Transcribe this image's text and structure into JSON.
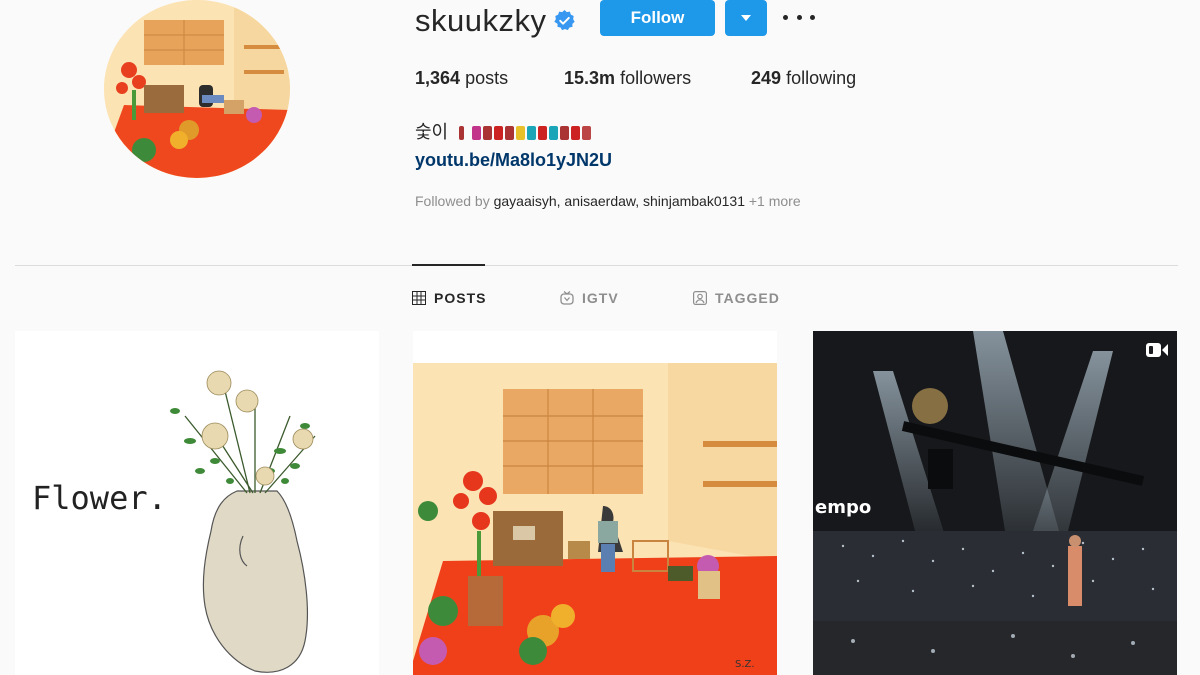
{
  "profile": {
    "username": "skuukzky",
    "follow_label": "Follow",
    "stats": {
      "posts_count": "1,364",
      "posts_label": "posts",
      "followers_count": "15.3m",
      "followers_label": "followers",
      "following_count": "249",
      "following_label": "following"
    },
    "bio_text": "숯이",
    "link": "youtu.be/Ma8lo1yJN2U",
    "followed_by_prefix": "Followed by",
    "followed_by_names": "gayaaisyh, anisaerdaw, shinjambak0131",
    "followed_by_more": "+1 more"
  },
  "tabs": [
    {
      "label": "POSTS",
      "icon": "grid-icon",
      "active": true
    },
    {
      "label": "IGTV",
      "icon": "igtv-icon",
      "active": false
    },
    {
      "label": "TAGGED",
      "icon": "tagged-icon",
      "active": false
    }
  ],
  "posts": [
    {
      "type": "illustration",
      "text": "Flower."
    },
    {
      "type": "illustration",
      "signature": "S.Z."
    },
    {
      "type": "video",
      "stage_text": "empo",
      "icon": "video-camera-icon"
    }
  ],
  "colors": {
    "accent": "#0095f6",
    "link": "#00376b",
    "muted": "#8e8e8e",
    "divider": "#dbdbdb"
  }
}
